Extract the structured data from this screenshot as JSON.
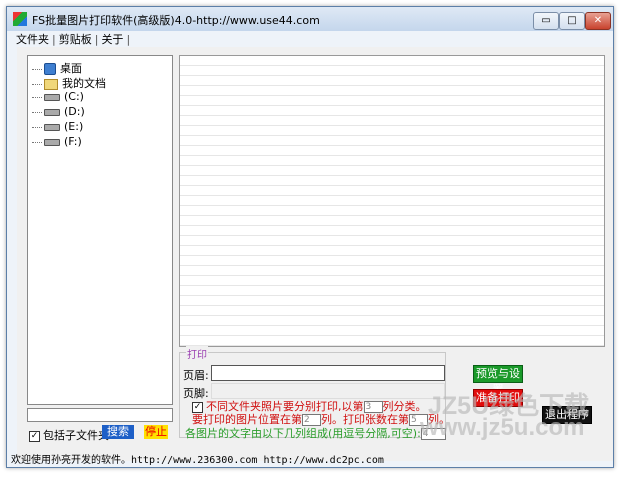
{
  "window": {
    "title": "FS批量图片打印软件(高级版)4.0-http://www.use44.com",
    "controls": {
      "minimize": "▭",
      "maximize": "□",
      "close": "✕"
    }
  },
  "menu": {
    "items": [
      "文件夹",
      "剪贴板",
      "关于"
    ],
    "trailing": "|"
  },
  "tree": {
    "items": [
      {
        "label": "桌面",
        "icon": "desktop-icon"
      },
      {
        "label": "我的文档",
        "icon": "folder-icon"
      },
      {
        "label": "(C:)",
        "icon": "drive-icon"
      },
      {
        "label": "(D:)",
        "icon": "drive-icon"
      },
      {
        "label": "(E:)",
        "icon": "drive-icon"
      },
      {
        "label": "(F:)",
        "icon": "drive-icon"
      }
    ]
  },
  "options": {
    "include_subfolders": "包括子文件夹",
    "search_button": "搜索",
    "stop_button": "停止"
  },
  "print": {
    "legend": "打印",
    "header_label": "页眉:",
    "header_value": "",
    "footer_label": "页脚:",
    "footer_value": "",
    "separate_folders": {
      "checked": true,
      "prefix": "不同文件夹照片要分别打印,以第",
      "value": "3",
      "suffix": "列分类。"
    },
    "image_position": {
      "prefix": "要打印的图片位置在第",
      "value": "2",
      "mid": "列。打印张数在第",
      "count": "5",
      "suffix": "列。"
    },
    "caption": {
      "prefix": "各图片的文字由以下几列组成(用逗号分隔,可空):",
      "value": "4"
    }
  },
  "buttons": {
    "preview": "预览与设置",
    "print": "准备打印",
    "exit": "退出程序"
  },
  "status": "欢迎使用孙亮开发的软件。http://www.236300.com http://www.dc2pc.com",
  "watermark": {
    "line1": "JZ5U绿色下载",
    "line2": "www.jz5u.com"
  },
  "colors": {
    "preview_button": "#1a9a2a",
    "print_button": "#e10c0c",
    "exit_button": "#111111",
    "search_button": "#1d5fc7",
    "stop_button": "#ffe100",
    "red_text": "#d01010",
    "green_text": "#2a9d2a"
  }
}
